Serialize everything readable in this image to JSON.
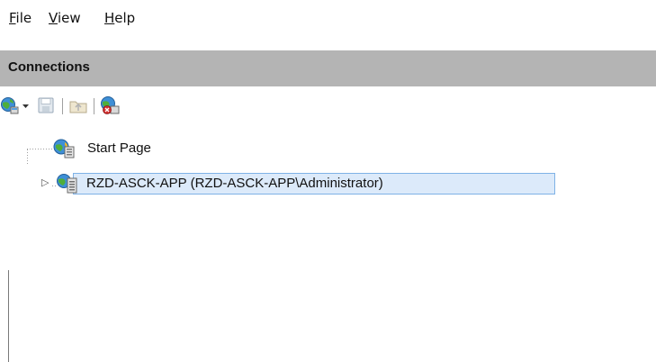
{
  "menu": {
    "file": {
      "underline": "F",
      "rest": "ile"
    },
    "view": {
      "underline": "V",
      "rest": "iew"
    },
    "help": {
      "underline": "H",
      "rest": "elp"
    }
  },
  "connections": {
    "title": "Connections"
  },
  "toolbar": {
    "icons": [
      "globe-connect-icon",
      "dropdown-arrow-icon",
      "save-icon",
      "up-level-icon",
      "disconnect-icon"
    ]
  },
  "tree": {
    "items": [
      {
        "label": "Start Page",
        "icon": "start-page-icon"
      },
      {
        "label": "RZD-ASCK-APP (RZD-ASCK-APP\\Administrator)",
        "icon": "server-icon",
        "expander": "▷",
        "selected": true
      }
    ]
  },
  "colors": {
    "header_bg": "#b4b4b4",
    "selection_bg": "#dceafa",
    "selection_border": "#7fb2e6"
  }
}
